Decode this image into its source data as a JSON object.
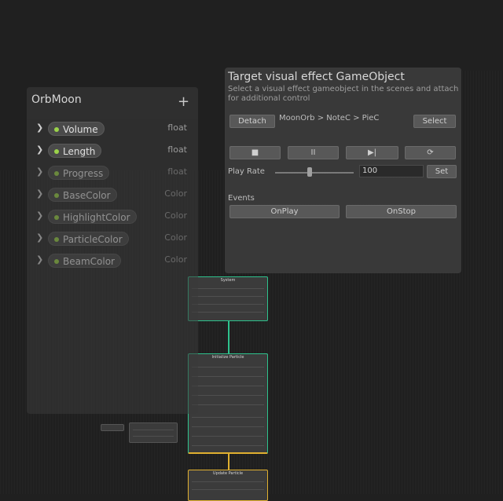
{
  "blackboard": {
    "title": "OrbMoon",
    "add_label": "+",
    "properties": [
      {
        "name": "Volume",
        "type": "float"
      },
      {
        "name": "Length",
        "type": "float"
      },
      {
        "name": "Progress",
        "type": "float"
      },
      {
        "name": "BaseColor",
        "type": "Color"
      },
      {
        "name": "HighlightColor",
        "type": "Color"
      },
      {
        "name": "ParticleColor",
        "type": "Color"
      },
      {
        "name": "BeamColor",
        "type": "Color"
      }
    ]
  },
  "target": {
    "title": "Target visual effect GameObject",
    "description": "Select a visual effect gameobject in the scenes and attach for additional control",
    "detach_label": "Detach",
    "path": "MoonOrb > NoteC > PieC",
    "select_label": "Select",
    "transport": [
      "■",
      "II",
      "▶|",
      "⟳"
    ],
    "play_rate_label": "Play Rate",
    "play_rate_value": "100",
    "set_label": "Set",
    "events_label": "Events",
    "onplay_label": "OnPlay",
    "onstop_label": "OnStop"
  },
  "graph": {
    "system_node_title": "System",
    "init_node_title": "Initialize Particle",
    "output_node_title": "Update Particle",
    "colors": {
      "green": "#2ec28d",
      "orange": "#e0b030"
    }
  }
}
